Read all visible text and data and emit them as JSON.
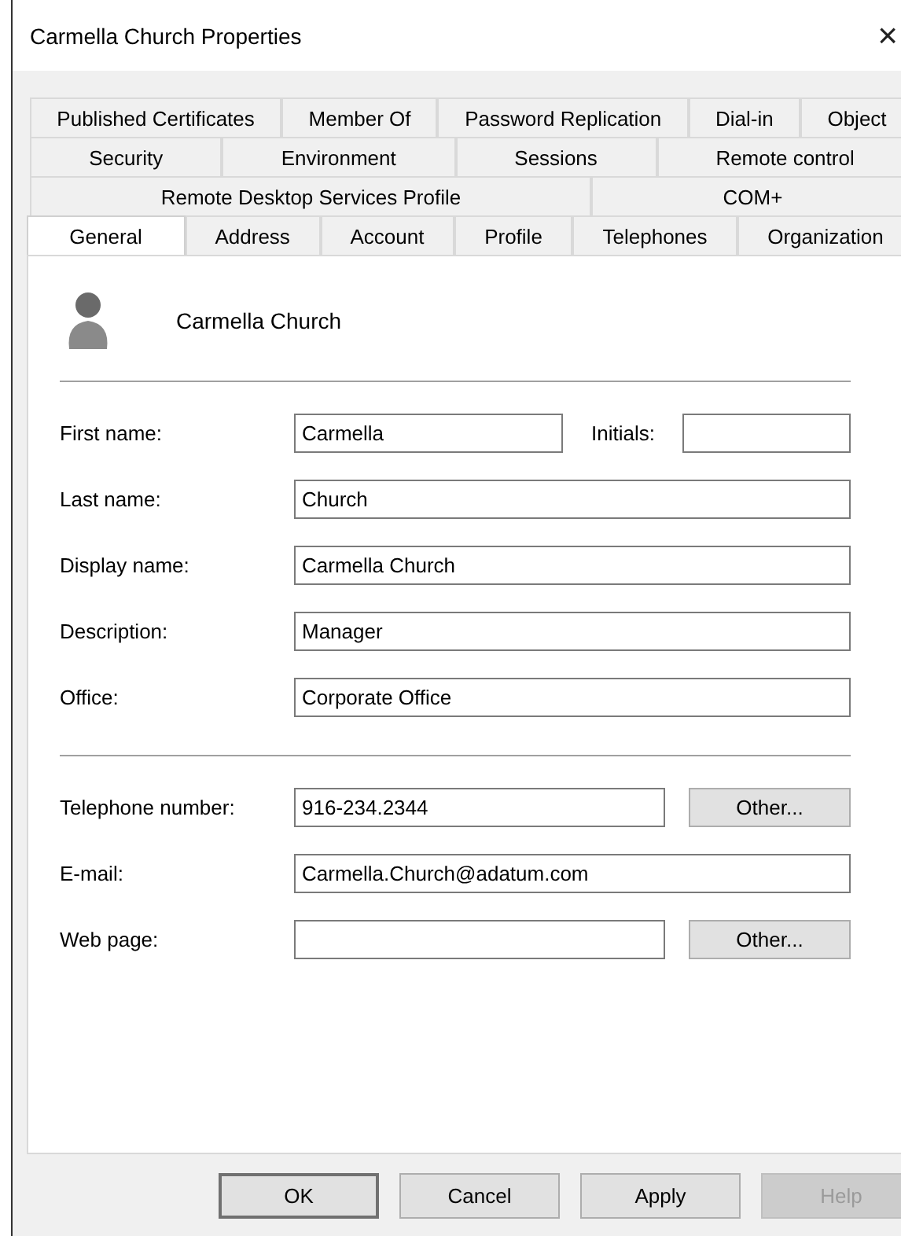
{
  "window": {
    "title": "Carmella Church Properties",
    "close": "×"
  },
  "tab_rows": [
    [
      {
        "label": "Published Certificates",
        "selected": false
      },
      {
        "label": "Member Of",
        "selected": false
      },
      {
        "label": "Password Replication",
        "selected": false
      },
      {
        "label": "Dial-in",
        "selected": false
      },
      {
        "label": "Object",
        "selected": false
      }
    ],
    [
      {
        "label": "Security",
        "selected": false
      },
      {
        "label": "Environment",
        "selected": false
      },
      {
        "label": "Sessions",
        "selected": false
      },
      {
        "label": "Remote control",
        "selected": false
      }
    ],
    [
      {
        "label": "Remote Desktop Services Profile",
        "selected": false
      },
      {
        "label": "COM+",
        "selected": false
      }
    ],
    [
      {
        "label": "General",
        "selected": true
      },
      {
        "label": "Address",
        "selected": false
      },
      {
        "label": "Account",
        "selected": false
      },
      {
        "label": "Profile",
        "selected": false
      },
      {
        "label": "Telephones",
        "selected": false
      },
      {
        "label": "Organization",
        "selected": false
      }
    ]
  ],
  "header": {
    "name": "Carmella Church"
  },
  "field_groups": [
    [
      {
        "label": "First name:",
        "value": "Carmella",
        "side": {
          "kind": "field",
          "label": "Initials:"
        }
      },
      {
        "label": "Last name:",
        "value": "Church"
      },
      {
        "label": "Display name:",
        "value": "Carmella Church"
      },
      {
        "label": "Description:",
        "value": "Manager"
      },
      {
        "label": "Office:",
        "value": "Corporate Office"
      }
    ],
    [
      {
        "label": "Telephone number:",
        "value": "916-234.2344",
        "side": {
          "kind": "button",
          "label": "Other..."
        }
      },
      {
        "label": "E-mail:",
        "value": "Carmella.Church@adatum.com"
      },
      {
        "label": "Web page:",
        "side": {
          "kind": "button",
          "label": "Other..."
        }
      }
    ]
  ],
  "buttons": [
    {
      "label": "OK",
      "default": true,
      "disabled": false
    },
    {
      "label": "Cancel",
      "default": false,
      "disabled": false
    },
    {
      "label": "Apply",
      "default": false,
      "disabled": false
    },
    {
      "label": "Help",
      "default": false,
      "disabled": true
    }
  ]
}
